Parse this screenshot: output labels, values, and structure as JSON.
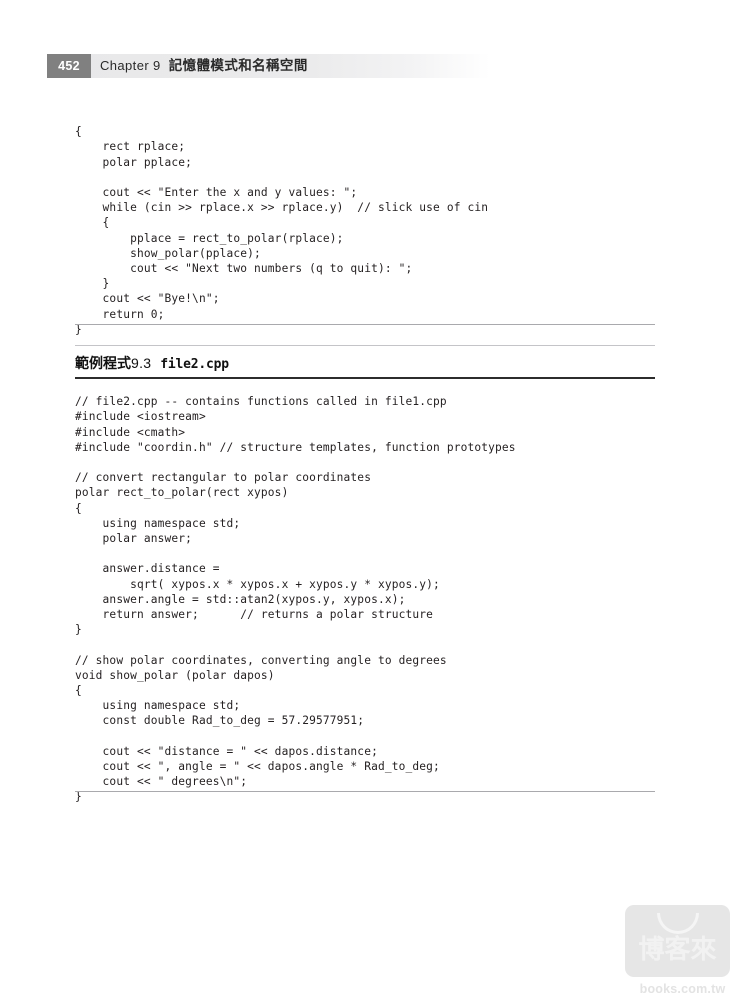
{
  "header": {
    "page_number": "452",
    "chapter": "Chapter 9",
    "chapter_title_cjk": "記憶體模式和名稱空間"
  },
  "listing_1": {
    "code": "{\n    rect rplace;\n    polar pplace;\n\n    cout << \"Enter the x and y values: \";\n    while (cin >> rplace.x >> rplace.y)  // slick use of cin\n    {\n        pplace = rect_to_polar(rplace);\n        show_polar(pplace);\n        cout << \"Next two numbers (q to quit): \";\n    }\n    cout << \"Bye!\\n\";\n    return 0;\n}"
  },
  "caption": {
    "label_cjk": "範例程式",
    "number": "9.3",
    "filename": "file2.cpp"
  },
  "listing_2": {
    "code": "// file2.cpp -- contains functions called in file1.cpp\n#include <iostream>\n#include <cmath>\n#include \"coordin.h\" // structure templates, function prototypes\n\n// convert rectangular to polar coordinates\npolar rect_to_polar(rect xypos)\n{\n    using namespace std;\n    polar answer;\n\n    answer.distance =\n        sqrt( xypos.x * xypos.x + xypos.y * xypos.y);\n    answer.angle = std::atan2(xypos.y, xypos.x);\n    return answer;      // returns a polar structure\n}\n\n// show polar coordinates, converting angle to degrees\nvoid show_polar (polar dapos)\n{\n    using namespace std;\n    const double Rad_to_deg = 57.29577951;\n\n    cout << \"distance = \" << dapos.distance;\n    cout << \", angle = \" << dapos.angle * Rad_to_deg;\n    cout << \" degrees\\n\";\n}"
  },
  "watermark": {
    "brand_cjk": "博客來",
    "url": "books.com.tw"
  },
  "colors": {
    "page_number_box": "#808080",
    "header_band": "#e8e8e9",
    "rule_dark": "#2c2c2c",
    "rule_light": "#a9a9ad",
    "text": "#231f20",
    "watermark": "#e6e6e6"
  }
}
